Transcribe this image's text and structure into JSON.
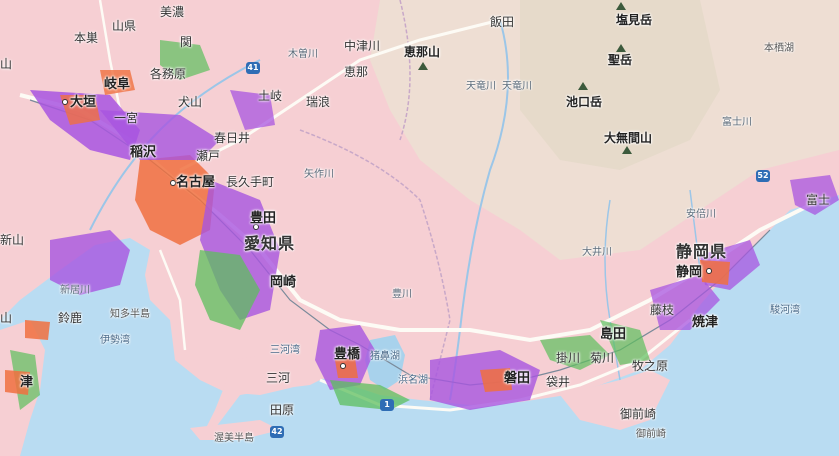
{
  "map": {
    "colors": {
      "land": "#f6cfd3",
      "mountain": "#e9dfcf",
      "sea": "#b9dcf2",
      "lake": "#a8d2ec",
      "urban_purple": "#a855e0",
      "urban_green": "#5dbf5d",
      "urban_orange": "#f07040",
      "road": "#fdfbf5",
      "river": "#9bc6e8",
      "border": "#c8a8c8"
    },
    "labels": {
      "mino": "美濃",
      "yamagata": "山県",
      "yama_left": "山",
      "motosu": "本巣",
      "seki": "関",
      "gifu": "岐阜",
      "kakamigahara": "各務原",
      "ogaki": "大垣",
      "ichinomiya": "一宮",
      "inuyama": "犬山",
      "kasugai": "春日井",
      "inazawa": "稲沢",
      "seto": "瀬戸",
      "nagoya": "名古屋",
      "nagakute": "長久手町",
      "toki": "土岐",
      "mizunami": "瑞浪",
      "toyota": "豊田",
      "aichi_pref": "愛知県",
      "okazaki": "岡崎",
      "nakatsugawa": "中津川",
      "ena": "恵那",
      "enasan": "恵那山",
      "kisogawa": "木曽川",
      "yahagigawa": "矢作川",
      "iida": "飯田",
      "tenryugawa_1": "天竜川",
      "tenryugawa_2": "天竜川",
      "shiomidake": "塩見岳",
      "hijiridake": "聖岳",
      "ikeguchidake": "池口岳",
      "daimugenzan": "大無間山",
      "motosuko": "本栖湖",
      "fujikawa": "富士川",
      "fuji": "富士",
      "abegawa": "安倍川",
      "shizuoka_pref": "静岡県",
      "shizuoka": "静岡",
      "oigawa": "大井川",
      "toyogawa": "豊川",
      "fujieda": "藤枝",
      "yaizu": "焼津",
      "shimada": "島田",
      "kakegawa": "掛川",
      "kikugawa": "菊川",
      "makinohara": "牧之原",
      "iwata": "磐田",
      "fukuroi": "袋井",
      "hamanako": "浜名湖",
      "inohanako": "猪鼻湖",
      "toyohashi": "豊橋",
      "mikawako": "三河湾",
      "mikawa": "三河",
      "tahara": "田原",
      "atsumi": "渥美半島",
      "chita": "知多半島",
      "isewan": "伊勢湾",
      "suzuka": "鈴鹿",
      "tsu": "津",
      "shin": "新山",
      "hamachi": "新居川",
      "omaezaki": "御前崎",
      "omaezaki2": "御前崎",
      "surugawan": "駿河湾",
      "route_1": "1",
      "route_42": "42",
      "route_52": "52",
      "route_41": "41",
      "ku_gifu_left": "山"
    }
  }
}
